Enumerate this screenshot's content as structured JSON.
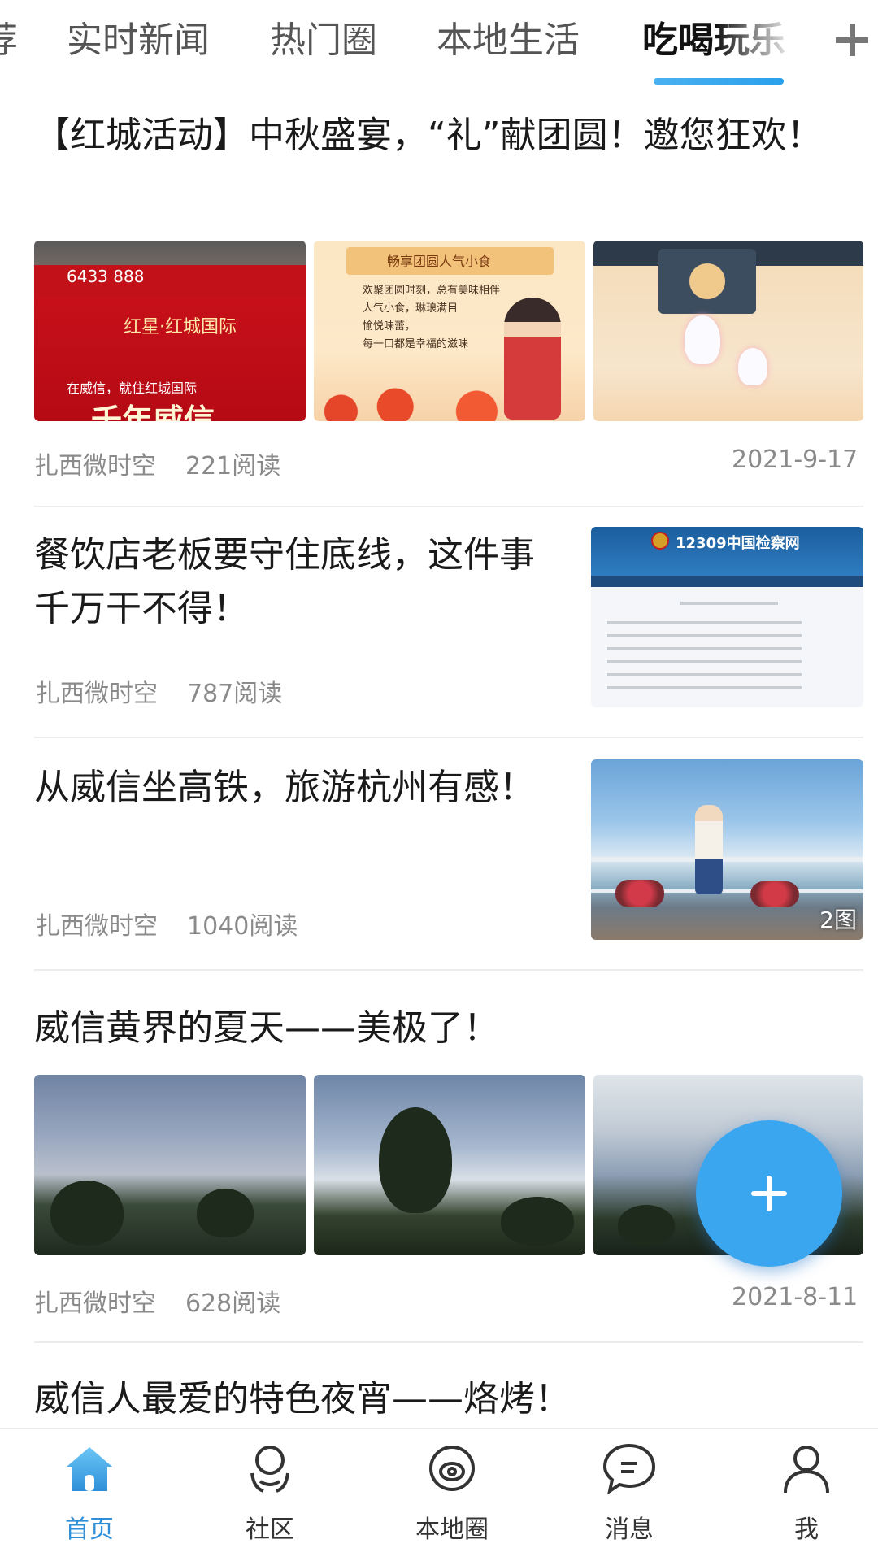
{
  "tabs": [
    {
      "label": "荐",
      "active": false
    },
    {
      "label": "实时新闻",
      "active": false
    },
    {
      "label": "热门圈",
      "active": false
    },
    {
      "label": "本地生活",
      "active": false
    },
    {
      "label": "吃喝玩乐",
      "active": true
    }
  ],
  "tab_add_icon": "plus-icon",
  "accent_color": "#2aa0ec",
  "articles": [
    {
      "title": "【红城活动】中秋盛宴，“礼”献团圆！邀您狂欢！",
      "source": "扎西微时空",
      "reads": "221阅读",
      "date": "2021-9-17",
      "images": {
        "img1_phone": "6433 888",
        "img1_brand": "红星·红城国际",
        "img1_slogan": "在威信，就住红城国际",
        "img1_big": "千年威信",
        "img2_header": "畅享团圆人气小食",
        "img2_lines": [
          "欢聚团圆时刻，总有美味相伴",
          "人气小食，琳琅满目",
          "愉悦味蕾，",
          "每一口都是幸福的滋味"
        ]
      }
    },
    {
      "title": "餐饮店老板要守住底线，这件事千万干不得！",
      "source": "扎西微时空",
      "reads": "787阅读",
      "images": {
        "header": "12309中国检察网"
      }
    },
    {
      "title": "从威信坐高铁，旅游杭州有感！",
      "source": "扎西微时空",
      "reads": "1040阅读",
      "image_count": "2图"
    },
    {
      "title": "威信黄界的夏天——美极了！",
      "source": "扎西微时空",
      "reads": "628阅读",
      "date": "2021-8-11"
    },
    {
      "title": "威信人最爱的特色夜宵——烙烤！"
    }
  ],
  "fab_icon": "plus-icon",
  "bottom_nav": [
    {
      "label": "首页",
      "icon": "home-icon",
      "active": true
    },
    {
      "label": "社区",
      "icon": "community-icon",
      "active": false
    },
    {
      "label": "本地圈",
      "icon": "planet-icon",
      "active": false
    },
    {
      "label": "消息",
      "icon": "message-icon",
      "active": false
    },
    {
      "label": "我",
      "icon": "user-icon",
      "active": false
    }
  ]
}
